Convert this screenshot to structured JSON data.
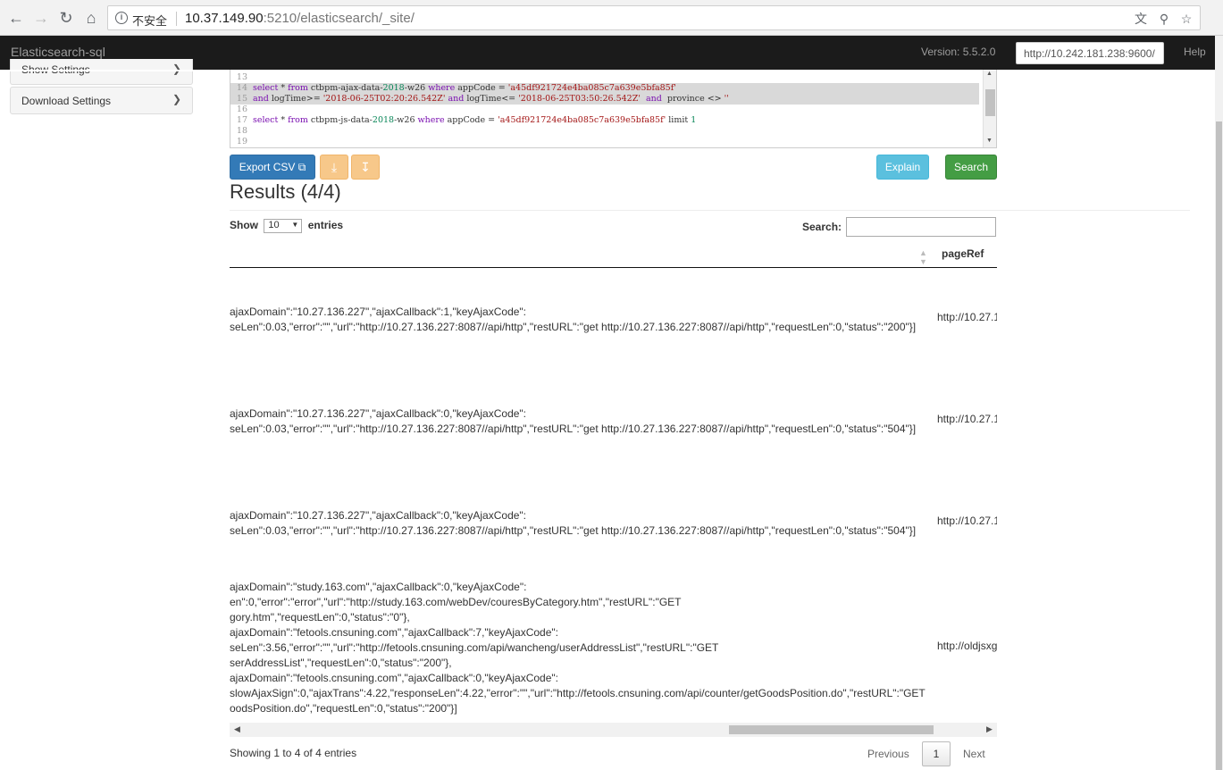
{
  "browser": {
    "security_label": "不安全",
    "url_host": "10.37.149.90",
    "url_rest": ":5210/elasticsearch/_site/"
  },
  "app": {
    "brand": "Elasticsearch-sql",
    "version": "Version: 5.5.2.0",
    "host_value": "http://10.242.181.238:9600/",
    "help": "Help"
  },
  "sidebar": {
    "show_settings": "Show Settings",
    "download_settings": "Download Settings"
  },
  "editor": {
    "lines": [
      {
        "n": "13",
        "parts": []
      },
      {
        "n": "14",
        "hl": true,
        "parts": [
          {
            "t": "select",
            "c": "kw"
          },
          {
            "t": " * "
          },
          {
            "t": "from",
            "c": "kw"
          },
          {
            "t": " ctbpm-ajax-data-"
          },
          {
            "t": "2018",
            "c": "num"
          },
          {
            "t": "-w26 "
          },
          {
            "t": "where",
            "c": "kw"
          },
          {
            "t": " appCode = "
          },
          {
            "t": "'a45df921724e4ba085c7a639e5bfa85f'",
            "c": "str"
          }
        ]
      },
      {
        "n": "15",
        "hl": true,
        "parts": [
          {
            "t": "and",
            "c": "kw"
          },
          {
            "t": " logTime>= "
          },
          {
            "t": "'2018-06-25T02:20:26.542Z'",
            "c": "str"
          },
          {
            "t": " "
          },
          {
            "t": "and",
            "c": "kw"
          },
          {
            "t": " logTime<= "
          },
          {
            "t": "'2018-06-25T03:50:26.542Z'",
            "c": "str"
          },
          {
            "t": "  "
          },
          {
            "t": "and",
            "c": "kw"
          },
          {
            "t": "  province <> "
          },
          {
            "t": "''",
            "c": "str"
          }
        ]
      },
      {
        "n": "16",
        "parts": []
      },
      {
        "n": "17",
        "parts": [
          {
            "t": "select",
            "c": "kw"
          },
          {
            "t": " * "
          },
          {
            "t": "from",
            "c": "kw"
          },
          {
            "t": " ctbpm-js-data-"
          },
          {
            "t": "2018",
            "c": "num"
          },
          {
            "t": "-w26 "
          },
          {
            "t": "where",
            "c": "kw"
          },
          {
            "t": " appCode = "
          },
          {
            "t": "'a45df921724e4ba085c7a639e5bfa85f'",
            "c": "str"
          },
          {
            "t": " limit "
          },
          {
            "t": "1",
            "c": "num"
          }
        ]
      },
      {
        "n": "18",
        "parts": []
      },
      {
        "n": "19",
        "parts": []
      }
    ]
  },
  "toolbar": {
    "export_label": "Export CSV",
    "explain_label": "Explain",
    "search_label": "Search"
  },
  "results": {
    "title": "Results (4/4)",
    "show_label": "Show",
    "page_length": "10",
    "entries_label": "entries",
    "search_label": "Search:",
    "column_header": "pageRef",
    "rows": [
      {
        "lines": [
          "ajaxDomain\":\"10.27.136.227\",\"ajaxCallback\":1,\"keyAjaxCode\":",
          "seLen\":0.03,\"error\":\"\",\"url\":\"http://10.27.136.227:8087//api/http\",\"restURL\":\"get http://10.27.136.227:8087//api/http\",\"requestLen\":0,\"status\":\"200\"}]"
        ],
        "ref": "http://10.27.1"
      },
      {
        "lines": [
          "ajaxDomain\":\"10.27.136.227\",\"ajaxCallback\":0,\"keyAjaxCode\":",
          "seLen\":0.03,\"error\":\"\",\"url\":\"http://10.27.136.227:8087//api/http\",\"restURL\":\"get http://10.27.136.227:8087//api/http\",\"requestLen\":0,\"status\":\"504\"}]"
        ],
        "ref": "http://10.27.1"
      },
      {
        "lines": [
          "ajaxDomain\":\"10.27.136.227\",\"ajaxCallback\":0,\"keyAjaxCode\":",
          "seLen\":0.03,\"error\":\"\",\"url\":\"http://10.27.136.227:8087//api/http\",\"restURL\":\"get http://10.27.136.227:8087//api/http\",\"requestLen\":0,\"status\":\"504\"}]"
        ],
        "ref": "http://10.27.1"
      },
      {
        "lines": [
          "ajaxDomain\":\"study.163.com\",\"ajaxCallback\":0,\"keyAjaxCode\":",
          "en\":0,\"error\":\"error\",\"url\":\"http://study.163.com/webDev/couresByCategory.htm\",\"restURL\":\"GET",
          "gory.htm\",\"requestLen\":0,\"status\":\"0\"},",
          "ajaxDomain\":\"fetools.cnsuning.com\",\"ajaxCallback\":7,\"keyAjaxCode\":",
          "seLen\":3.56,\"error\":\"\",\"url\":\"http://fetools.cnsuning.com/api/wancheng/userAddressList\",\"restURL\":\"GET",
          "serAddressList\",\"requestLen\":0,\"status\":\"200\"},",
          "ajaxDomain\":\"fetools.cnsuning.com\",\"ajaxCallback\":0,\"keyAjaxCode\":",
          "slowAjaxSign\":0,\"ajaxTrans\":4.22,\"responseLen\":4.22,\"error\":\"\",\"url\":\"http://fetools.cnsuning.com/api/counter/getGoodsPosition.do\",\"restURL\":\"GET",
          "oodsPosition.do\",\"requestLen\":0,\"status\":\"200\"}]"
        ],
        "ref": "http://oldjsxg"
      }
    ],
    "info": "Showing 1 to 4 of 4 entries",
    "prev": "Previous",
    "page": "1",
    "next": "Next"
  }
}
